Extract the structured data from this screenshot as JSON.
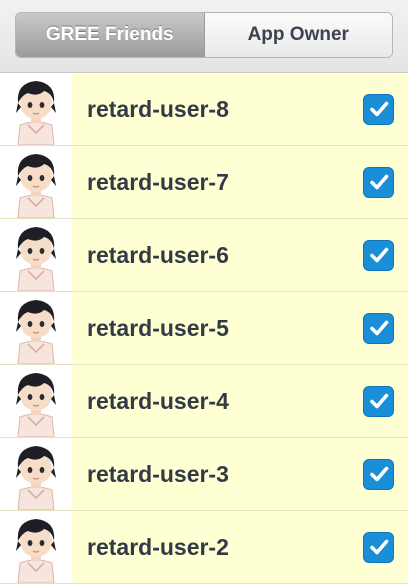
{
  "tabs": {
    "gree_friends": "GREE Friends",
    "app_owner": "App Owner"
  },
  "users": [
    {
      "name": "retard-user-8",
      "checked": true
    },
    {
      "name": "retard-user-7",
      "checked": true
    },
    {
      "name": "retard-user-6",
      "checked": true
    },
    {
      "name": "retard-user-5",
      "checked": true
    },
    {
      "name": "retard-user-4",
      "checked": true
    },
    {
      "name": "retard-user-3",
      "checked": true
    },
    {
      "name": "retard-user-2",
      "checked": true
    }
  ],
  "colors": {
    "row_background": "#ffffd4",
    "checkbox": "#1a8fd8",
    "text": "#333a45"
  },
  "icons": {
    "avatar": "avatar-icon",
    "checkbox": "checkmark-icon"
  }
}
